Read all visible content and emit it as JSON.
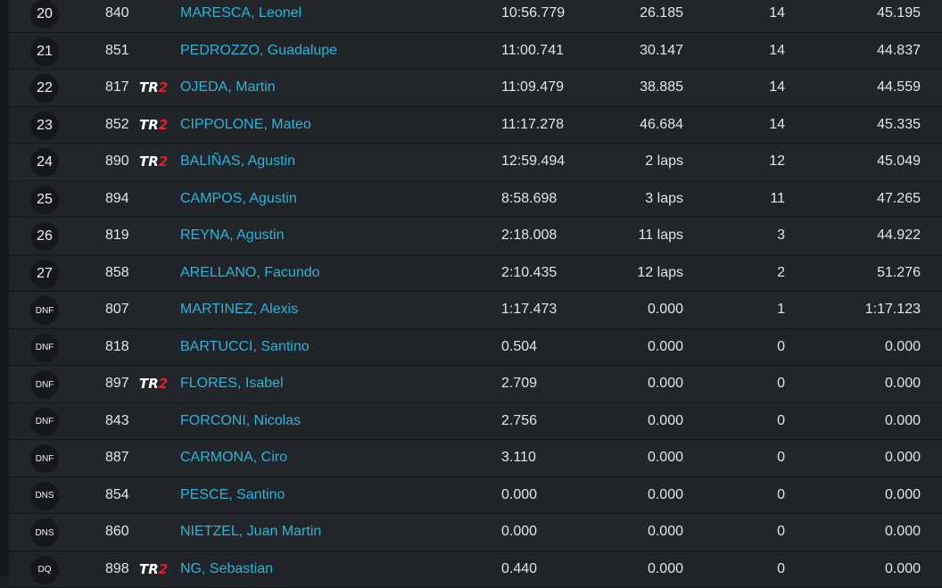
{
  "rows": [
    {
      "pos": "20",
      "number": "840",
      "category": "",
      "driver": "MARESCA, Leonel",
      "time": "10:56.779",
      "gap": "26.185",
      "laps": "14",
      "best": "45.195"
    },
    {
      "pos": "21",
      "number": "851",
      "category": "",
      "driver": "PEDROZZO, Guadalupe",
      "time": "11:00.741",
      "gap": "30.147",
      "laps": "14",
      "best": "44.837"
    },
    {
      "pos": "22",
      "number": "817",
      "category": "TR2",
      "driver": "OJEDA, Martin",
      "time": "11:09.479",
      "gap": "38.885",
      "laps": "14",
      "best": "44.559"
    },
    {
      "pos": "23",
      "number": "852",
      "category": "TR2",
      "driver": "CIPPOLONE, Mateo",
      "time": "11:17.278",
      "gap": "46.684",
      "laps": "14",
      "best": "45.335"
    },
    {
      "pos": "24",
      "number": "890",
      "category": "TR2",
      "driver": "BALIÑAS, Agustin",
      "time": "12:59.494",
      "gap": "2 laps",
      "laps": "12",
      "best": "45.049"
    },
    {
      "pos": "25",
      "number": "894",
      "category": "",
      "driver": "CAMPOS, Agustin",
      "time": "8:58.698",
      "gap": "3 laps",
      "laps": "11",
      "best": "47.265"
    },
    {
      "pos": "26",
      "number": "819",
      "category": "",
      "driver": "REYNA, Agustin",
      "time": "2:18.008",
      "gap": "11 laps",
      "laps": "3",
      "best": "44.922"
    },
    {
      "pos": "27",
      "number": "858",
      "category": "",
      "driver": "ARELLANO, Facundo",
      "time": "2:10.435",
      "gap": "12 laps",
      "laps": "2",
      "best": "51.276"
    },
    {
      "pos": "DNF",
      "number": "807",
      "category": "",
      "driver": "MARTINEZ, Alexis",
      "time": "1:17.473",
      "gap": "0.000",
      "laps": "1",
      "best": "1:17.123"
    },
    {
      "pos": "DNF",
      "number": "818",
      "category": "",
      "driver": "BARTUCCI, Santino",
      "time": "0.504",
      "gap": "0.000",
      "laps": "0",
      "best": "0.000"
    },
    {
      "pos": "DNF",
      "number": "897",
      "category": "TR2",
      "driver": "FLORES, Isabel",
      "time": "2.709",
      "gap": "0.000",
      "laps": "0",
      "best": "0.000"
    },
    {
      "pos": "DNF",
      "number": "843",
      "category": "",
      "driver": "FORCONI, Nicolas",
      "time": "2.756",
      "gap": "0.000",
      "laps": "0",
      "best": "0.000"
    },
    {
      "pos": "DNF",
      "number": "887",
      "category": "",
      "driver": "CARMONA, Ciro",
      "time": "3.110",
      "gap": "0.000",
      "laps": "0",
      "best": "0.000"
    },
    {
      "pos": "DNS",
      "number": "854",
      "category": "",
      "driver": "PESCE, Santino",
      "time": "0.000",
      "gap": "0.000",
      "laps": "0",
      "best": "0.000"
    },
    {
      "pos": "DNS",
      "number": "860",
      "category": "",
      "driver": "NIETZEL, Juan Martin",
      "time": "0.000",
      "gap": "0.000",
      "laps": "0",
      "best": "0.000"
    },
    {
      "pos": "DQ",
      "number": "898",
      "category": "TR2",
      "driver": "NG, Sebastian",
      "time": "0.440",
      "gap": "0.000",
      "laps": "0",
      "best": "0.000"
    }
  ],
  "colors": {
    "background": "#1d2024",
    "row_bg": "#22252a",
    "row_alt_bg": "#202328",
    "driver_link": "#2bb5d8",
    "text": "#e4e4e4",
    "badge_bg": "#15171a",
    "tr2_red": "#e0202a"
  },
  "icons": {
    "category_logo": "tr2-logo"
  }
}
